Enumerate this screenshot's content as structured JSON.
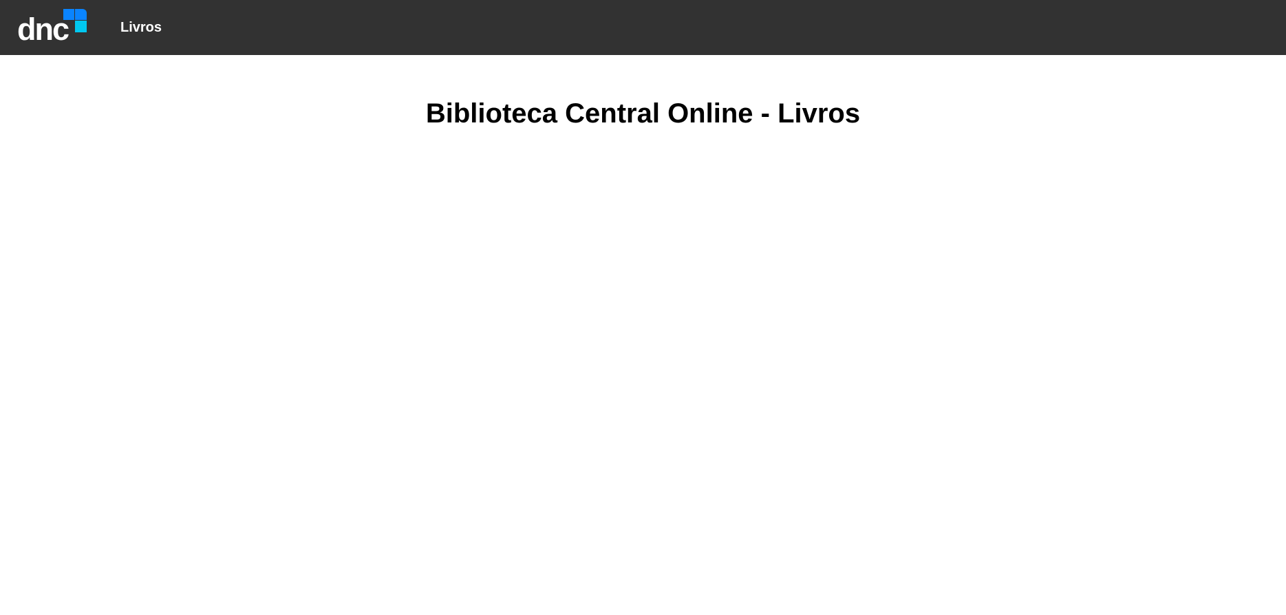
{
  "header": {
    "logo": {
      "text": "dnc",
      "icon": "dnc-squares-logo-icon"
    },
    "nav": [
      {
        "label": "Livros"
      }
    ]
  },
  "main": {
    "title": "Biblioteca Central Online - Livros"
  },
  "colors": {
    "header_background": "#323232",
    "logo_blue": "#0a84ff",
    "logo_cyan": "#00c8f0",
    "text_on_header": "#ffffff",
    "page_background": "#ffffff",
    "title_text": "#000000"
  }
}
